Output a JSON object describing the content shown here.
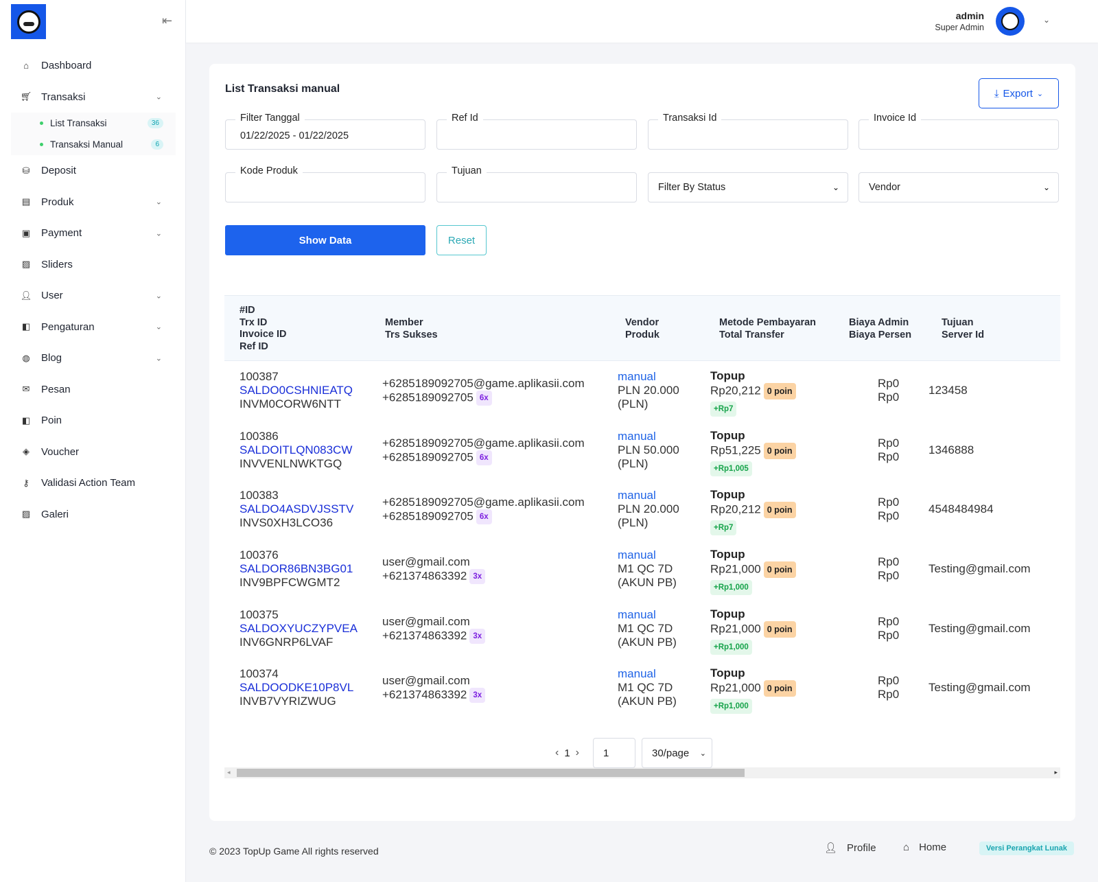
{
  "sidebar": {
    "collapse_icon": "collapse-left-icon",
    "items": [
      {
        "label": "Dashboard",
        "icon": "home-icon"
      },
      {
        "label": "Transaksi",
        "icon": "cart-icon"
      },
      {
        "label": "Deposit",
        "icon": "deposit-icon"
      },
      {
        "label": "Produk",
        "icon": "store-icon"
      },
      {
        "label": "Payment",
        "icon": "wallet-icon"
      },
      {
        "label": "Sliders",
        "icon": "image-icon"
      },
      {
        "label": "User",
        "icon": "user-icon"
      },
      {
        "label": "Pengaturan",
        "icon": "settings-icon"
      },
      {
        "label": "Blog",
        "icon": "globe-icon"
      },
      {
        "label": "Pesan",
        "icon": "mail-icon"
      },
      {
        "label": "Poin",
        "icon": "poin-icon"
      },
      {
        "label": "Voucher",
        "icon": "tag-icon"
      },
      {
        "label": "Validasi Action Team",
        "icon": "key-icon"
      },
      {
        "label": "Galeri",
        "icon": "gallery-icon"
      }
    ],
    "sub_items": [
      {
        "label": "List Transaksi",
        "badge": "36"
      },
      {
        "label": "Transaksi Manual",
        "badge": "6"
      }
    ]
  },
  "topbar": {
    "user_name": "admin",
    "user_role": "Super Admin"
  },
  "card": {
    "title": "List Transaksi manual",
    "export_label": "Export"
  },
  "filters": {
    "tanggal_label": "Filter Tanggal",
    "tanggal_value": "01/22/2025 - 01/22/2025",
    "ref_label": "Ref Id",
    "trx_label": "Transaksi Id",
    "invoice_label": "Invoice Id",
    "kode_label": "Kode Produk",
    "tujuan_label": "Tujuan",
    "status_value": "Filter By Status",
    "vendor_value": "Vendor",
    "show_label": "Show Data",
    "reset_label": "Reset"
  },
  "table": {
    "headers": {
      "id": [
        "#ID",
        "Trx ID",
        "Invoice ID",
        "Ref ID"
      ],
      "member": [
        "Member",
        "Trs Sukses"
      ],
      "vendor": [
        "Vendor",
        "Produk"
      ],
      "metode": [
        "Metode Pembayaran",
        "Total Transfer"
      ],
      "biaya": [
        "Biaya Admin",
        "Biaya Persen"
      ],
      "tujuan": [
        "Tujuan",
        "Server Id"
      ]
    },
    "rows": [
      {
        "id": "100387",
        "trx": "SALDO0CSHNIEATQ",
        "inv": "INVM0CORW6NTT",
        "member": "+6285189092705@game.aplikasii.com",
        "phone": "+6285189092705",
        "sukses": "6x",
        "vendor": "manual",
        "produk1": "PLN 20.000",
        "produk2": "(PLN)",
        "metode": "Topup",
        "total": "Rp20,212",
        "poin": "0 poin",
        "plus": "+Rp7",
        "admin": "Rp0",
        "persen": "Rp0",
        "tujuan": "123458"
      },
      {
        "id": "100386",
        "trx": "SALDOITLQN083CW",
        "inv": "INVVENLNWKTGQ",
        "member": "+6285189092705@game.aplikasii.com",
        "phone": "+6285189092705",
        "sukses": "6x",
        "vendor": "manual",
        "produk1": "PLN 50.000",
        "produk2": "(PLN)",
        "metode": "Topup",
        "total": "Rp51,225",
        "poin": "0 poin",
        "plus": "+Rp1,005",
        "admin": "Rp0",
        "persen": "Rp0",
        "tujuan": "1346888"
      },
      {
        "id": "100383",
        "trx": "SALDO4ASDVJSSTV",
        "inv": "INVS0XH3LCO36",
        "member": "+6285189092705@game.aplikasii.com",
        "phone": "+6285189092705",
        "sukses": "6x",
        "vendor": "manual",
        "produk1": "PLN 20.000",
        "produk2": "(PLN)",
        "metode": "Topup",
        "total": "Rp20,212",
        "poin": "0 poin",
        "plus": "+Rp7",
        "admin": "Rp0",
        "persen": "Rp0",
        "tujuan": "4548484984"
      },
      {
        "id": "100376",
        "trx": "SALDOR86BN3BG01",
        "inv": "INV9BPFCWGMT2",
        "member": "user@gmail.com",
        "phone": "+621374863392",
        "sukses": "3x",
        "vendor": "manual",
        "produk1": "M1 QC 7D",
        "produk2": "(AKUN PB)",
        "metode": "Topup",
        "total": "Rp21,000",
        "poin": "0 poin",
        "plus": "+Rp1,000",
        "admin": "Rp0",
        "persen": "Rp0",
        "tujuan": "Testing@gmail.com"
      },
      {
        "id": "100375",
        "trx": "SALDOXYUCZYPVEA",
        "inv": "INV6GNRP6LVAF",
        "member": "user@gmail.com",
        "phone": "+621374863392",
        "sukses": "3x",
        "vendor": "manual",
        "produk1": "M1 QC 7D",
        "produk2": "(AKUN PB)",
        "metode": "Topup",
        "total": "Rp21,000",
        "poin": "0 poin",
        "plus": "+Rp1,000",
        "admin": "Rp0",
        "persen": "Rp0",
        "tujuan": "Testing@gmail.com"
      },
      {
        "id": "100374",
        "trx": "SALDOODKE10P8VL",
        "inv": "INVB7VYRIZWUG",
        "member": "user@gmail.com",
        "phone": "+621374863392",
        "sukses": "3x",
        "vendor": "manual",
        "produk1": "M1 QC 7D",
        "produk2": "(AKUN PB)",
        "metode": "Topup",
        "total": "Rp21,000",
        "poin": "0 poin",
        "plus": "+Rp1,000",
        "admin": "Rp0",
        "persen": "Rp0",
        "tujuan": "Testing@gmail.com"
      }
    ]
  },
  "pagination": {
    "current": "1",
    "input_value": "1",
    "page_size": "30/page"
  },
  "footer": {
    "copyright": "© 2023 TopUp Game All rights reserved",
    "profile_label": "Profile",
    "home_label": "Home",
    "version_label": "Versi Perangkat Lunak"
  }
}
